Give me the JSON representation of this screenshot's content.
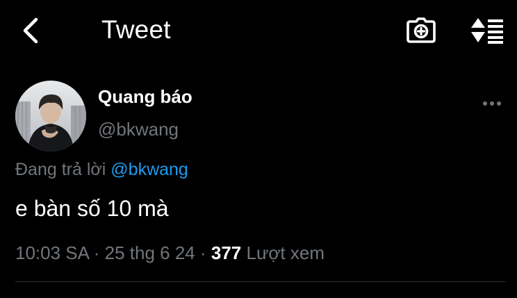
{
  "header": {
    "back_icon": "chevron-left-icon",
    "title": "Tweet",
    "camera_icon": "camera-plus-icon",
    "sort_icon": "sort-arrows-list-icon"
  },
  "tweet": {
    "author": {
      "display_name": "Quang báo",
      "handle": "@bkwang",
      "avatar_icon": "profile-avatar"
    },
    "more_icon": "more-dots-icon",
    "reply": {
      "prefix": "Đang trả lời ",
      "mention": "@bkwang"
    },
    "text": "e bàn số 10 mà",
    "meta": {
      "time": "10:03 SA",
      "separator": " · ",
      "date": "25 thg 6 24",
      "views_count": "377",
      "views_label": " Lượt xem"
    }
  },
  "colors": {
    "background": "#000000",
    "text_primary": "#ffffff",
    "text_secondary": "#71767b",
    "link": "#1d9bf0",
    "divider": "#2f3336"
  }
}
